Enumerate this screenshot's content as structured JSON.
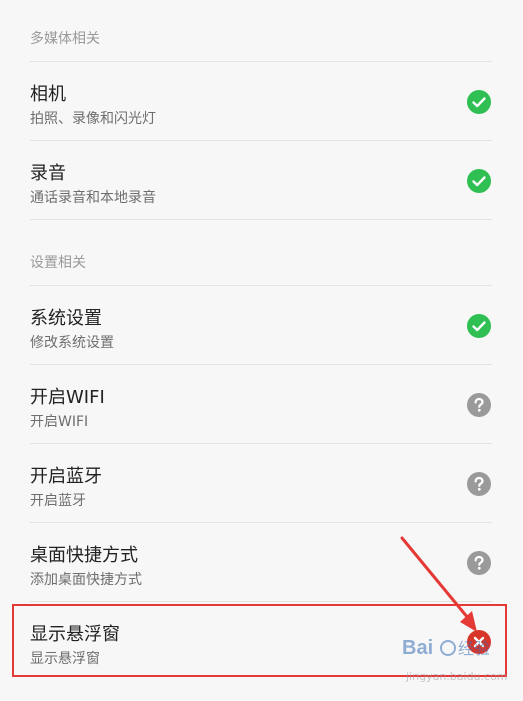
{
  "sections": [
    {
      "header": "多媒体相关",
      "items": [
        {
          "title": "相机",
          "subtitle": "拍照、录像和闪光灯",
          "status": "allowed",
          "icon": "check-circle-icon"
        },
        {
          "title": "录音",
          "subtitle": "通话录音和本地录音",
          "status": "allowed",
          "icon": "check-circle-icon"
        }
      ]
    },
    {
      "header": "设置相关",
      "items": [
        {
          "title": "系统设置",
          "subtitle": "修改系统设置",
          "status": "allowed",
          "icon": "check-circle-icon"
        },
        {
          "title": "开启WIFI",
          "subtitle": "开启WIFI",
          "status": "ask",
          "icon": "question-circle-icon"
        },
        {
          "title": "开启蓝牙",
          "subtitle": "开启蓝牙",
          "status": "ask",
          "icon": "question-circle-icon"
        },
        {
          "title": "桌面快捷方式",
          "subtitle": "添加桌面快捷方式",
          "status": "ask",
          "icon": "question-circle-icon"
        },
        {
          "title": "显示悬浮窗",
          "subtitle": "显示悬浮窗",
          "status": "denied",
          "icon": "close-circle-icon"
        }
      ]
    }
  ],
  "annotation": {
    "highlight_color": "#e53935",
    "arrow_color": "#e53935"
  },
  "watermark": {
    "logo": "Baidu 经验",
    "url": "jingyan.baidu.com"
  },
  "colors": {
    "allowed": "#2fbf52",
    "ask": "#9a9a9a",
    "denied": "#d8352a"
  }
}
